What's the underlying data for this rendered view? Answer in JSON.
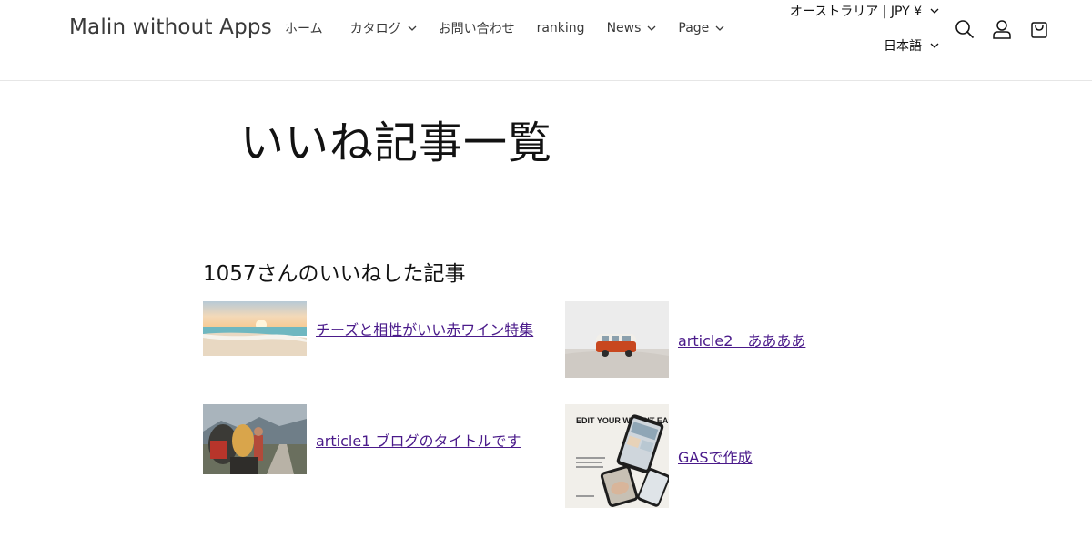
{
  "header": {
    "logo": "Malin without Apps",
    "nav": [
      {
        "label": "ホーム",
        "dropdown": false
      },
      {
        "label": "カタログ",
        "dropdown": true
      },
      {
        "label": "お問い合わせ",
        "dropdown": false
      },
      {
        "label": "ranking",
        "dropdown": false
      },
      {
        "label": "News",
        "dropdown": true
      },
      {
        "label": "Page",
        "dropdown": true
      }
    ],
    "country": "オーストラリア | JPY ¥",
    "language": "日本語",
    "icons": [
      "search-icon",
      "account-icon",
      "cart-icon"
    ]
  },
  "main": {
    "title": "いいね記事一覧",
    "section_title": "1057さんのいいねした記事",
    "articles": [
      {
        "title": "チーズと相性がいい赤ワイン特集",
        "thumb": "beach-sunset"
      },
      {
        "title": "article2　ああああ",
        "thumb": "red-van"
      },
      {
        "title": "article1 ブログのタイトルです",
        "thumb": "hikers"
      },
      {
        "title": "GASで作成",
        "thumb": "edit-your-website",
        "thumb_text": "EDIT YOUR WEBSIT EASYOU LI"
      }
    ]
  },
  "colors": {
    "link": "#4a1a8a",
    "text": "#121212",
    "border": "#e6e6e6"
  }
}
